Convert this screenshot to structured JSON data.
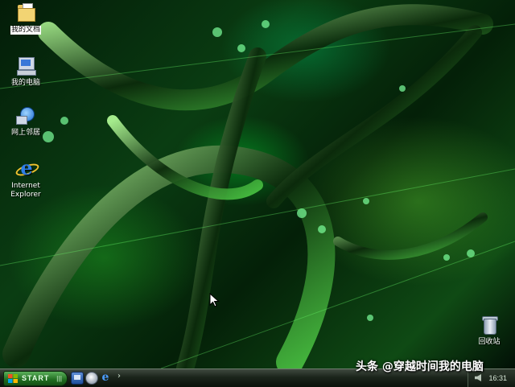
{
  "desktop": {
    "icons": [
      {
        "label": "我的文档",
        "icon": "my-documents-folder-icon",
        "selected": true
      },
      {
        "label": "我的电脑",
        "icon": "my-computer-icon"
      },
      {
        "label": "网上邻居",
        "icon": "network-places-icon"
      },
      {
        "label": "Internet Explorer",
        "icon": "internet-explorer-icon"
      },
      {
        "label": "回收站",
        "icon": "recycle-bin-icon"
      }
    ]
  },
  "taskbar": {
    "start_label": "START",
    "start_grip": "|||",
    "quick_launch": [
      "show-desktop-icon",
      "media-player-icon",
      "internet-explorer-icon"
    ],
    "overflow_chevron": "›",
    "clock": "16:31"
  },
  "watermark": "头条 @穿越时间我的电脑",
  "colors": {
    "accent": "#1f6b1f",
    "wallpaper_base": "#0a3d12"
  }
}
